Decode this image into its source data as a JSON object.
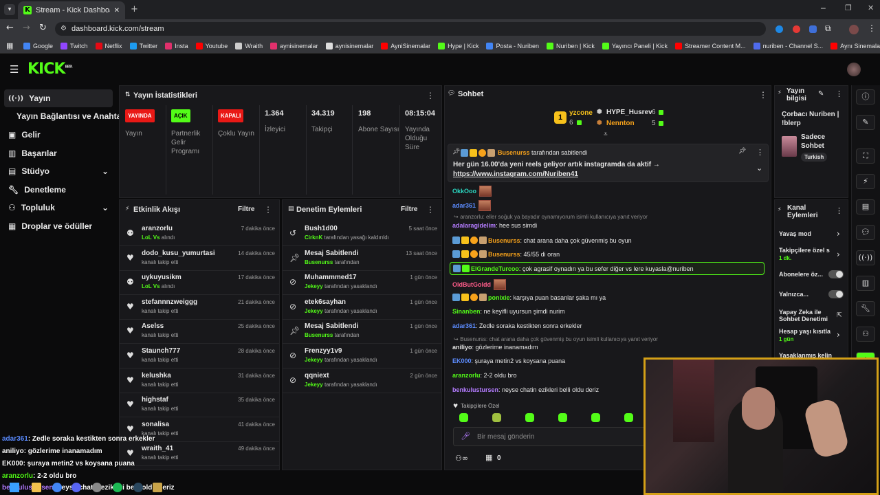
{
  "browser": {
    "tab_title": "Stream - Kick Dashboard",
    "url": "dashboard.kick.com/stream",
    "bookmarks": [
      {
        "label": "Google",
        "color": "#4285f4"
      },
      {
        "label": "Twitch",
        "color": "#9146ff"
      },
      {
        "label": "Netflix",
        "color": "#e50914"
      },
      {
        "label": "Twitter",
        "color": "#1d9bf0"
      },
      {
        "label": "Insta",
        "color": "#e1306c"
      },
      {
        "label": "Youtube",
        "color": "#ff0000"
      },
      {
        "label": "Wraith",
        "color": "#cccccc"
      },
      {
        "label": "aynisinemalar",
        "color": "#e1306c"
      },
      {
        "label": "aynisinemalar",
        "color": "#dddddd"
      },
      {
        "label": "AyniSinemalar",
        "color": "#ff0000"
      },
      {
        "label": "Hype | Kick",
        "color": "#53fc18"
      },
      {
        "label": "Posta - Nuriben",
        "color": "#4285f4"
      },
      {
        "label": "Nuriben | Kick",
        "color": "#53fc18"
      },
      {
        "label": "Yayıncı Paneli | Kick",
        "color": "#53fc18"
      },
      {
        "label": "Streamer Content M...",
        "color": "#ff0000"
      },
      {
        "label": "nuriben - Channel S...",
        "color": "#4f6bed"
      },
      {
        "label": "Aynı Sinemalar - Ça...",
        "color": "#ff0000"
      }
    ]
  },
  "sidebar": {
    "items": [
      {
        "label": "Yayın",
        "icon": "broadcast-icon"
      },
      {
        "label": "Yayın Bağlantısı ve Anahtarı"
      },
      {
        "label": "Gelir",
        "icon": "revenue-icon"
      },
      {
        "label": "Başarılar",
        "icon": "achievements-icon"
      },
      {
        "label": "Stüdyo",
        "icon": "studio-icon"
      },
      {
        "label": "Denetleme",
        "icon": "wrench-icon"
      },
      {
        "label": "Topluluk",
        "icon": "community-icon"
      },
      {
        "label": "Droplar ve ödüller",
        "icon": "drops-icon"
      }
    ]
  },
  "stats": {
    "title": "Yayın İstatistikleri",
    "cols": [
      {
        "badge": "YAYINDA",
        "badge_color": "#e91916",
        "label": "Yayın"
      },
      {
        "badge": "AÇIK",
        "badge_color": "#53fc18",
        "label": "Partnerlik Gelir Programı"
      },
      {
        "badge": "KAPALI",
        "badge_color": "#e91916",
        "label": "Çoklu Yayın"
      },
      {
        "value": "1.364",
        "label": "İzleyici"
      },
      {
        "value": "34.319",
        "label": "Takipçi"
      },
      {
        "value": "198",
        "label": "Abone Sayısı"
      },
      {
        "value": "08:15:04",
        "label": "Yayında Olduğu Süre"
      }
    ]
  },
  "activity": {
    "title": "Etkinlik Akışı",
    "filter": "Filtre",
    "items": [
      {
        "name": "aranzorlu",
        "sub_green": "LoL Vs",
        "sub": "alındı",
        "time": "7 dakika önce",
        "icon": "prediction-icon"
      },
      {
        "name": "dodo_kusu_yumurtasi",
        "sub": "kanalı takip etti",
        "time": "14 dakika önce",
        "icon": "heart-icon"
      },
      {
        "name": "uykuyusikm",
        "sub_green": "LoL Vs",
        "sub": "alındı",
        "time": "17 dakika önce",
        "icon": "prediction-icon"
      },
      {
        "name": "stefannnzweiggg",
        "sub": "kanalı takip etti",
        "time": "21 dakika önce",
        "icon": "heart-icon"
      },
      {
        "name": "Aselss",
        "sub": "kanalı takip etti",
        "time": "25 dakika önce",
        "icon": "heart-icon"
      },
      {
        "name": "Staunch777",
        "sub": "kanalı takip etti",
        "time": "28 dakika önce",
        "icon": "heart-icon"
      },
      {
        "name": "kelushka",
        "sub": "kanalı takip etti",
        "time": "31 dakika önce",
        "icon": "heart-icon"
      },
      {
        "name": "highstaf",
        "sub": "kanalı takip etti",
        "time": "35 dakika önce",
        "icon": "heart-icon"
      },
      {
        "name": "sonalisa",
        "sub": "kanalı takip etti",
        "time": "41 dakika önce",
        "icon": "heart-icon"
      },
      {
        "name": "wraith_41",
        "sub": "kanalı takip etti",
        "time": "49 dakika önce",
        "icon": "heart-icon"
      }
    ]
  },
  "moderation": {
    "title": "Denetim Eylemleri",
    "filter": "Filtre",
    "items": [
      {
        "name": "Bush1d00",
        "sub_green": "CirknK",
        "sub": "tarafından yasağı kaldırıldı",
        "time": "5 saat önce",
        "icon": "unban-icon"
      },
      {
        "name": "Mesaj Sabitlendi",
        "sub_green": "Busenurss",
        "sub": "tarafından",
        "time": "13 saat önce",
        "icon": "pin-icon"
      },
      {
        "name": "Muhammmed17",
        "sub_green": "Jekeyy",
        "sub": "tarafından yasaklandı",
        "time": "1 gün önce",
        "icon": "ban-icon"
      },
      {
        "name": "etek6sayhan",
        "sub_green": "Jekeyy",
        "sub": "tarafından yasaklandı",
        "time": "1 gün önce",
        "icon": "ban-icon"
      },
      {
        "name": "Mesaj Sabitlendi",
        "sub_green": "Busenurss",
        "sub": "tarafından",
        "time": "1 gün önce",
        "icon": "pin-icon"
      },
      {
        "name": "Frenzyy1v9",
        "sub_green": "Jekeyy",
        "sub": "tarafından yasaklandı",
        "time": "1 gün önce",
        "icon": "ban-icon"
      },
      {
        "name": "qqniext",
        "sub_green": "Jekeyy",
        "sub": "tarafından yasaklandı",
        "time": "2 gün önce",
        "icon": "ban-icon"
      }
    ]
  },
  "chat": {
    "title": "Sohbet",
    "leaders": [
      {
        "rank": "1",
        "name": "yzcone",
        "count": "6"
      },
      {
        "name": "HYPE_Husrev",
        "count": "6"
      },
      {
        "name": "Nennton",
        "count": "5"
      }
    ],
    "pinned": {
      "by": "Busenurss",
      "by_suffix": "tarafından sabitlendi",
      "text": "Her gün 16.00'da yeni reels geliyor artık instagramda da aktif →",
      "link": "https://www.instagram.com/Nuriben41"
    },
    "messages": [
      {
        "user": "OkkOoo",
        "color": "#2bd9c3",
        "text": "",
        "emote": true
      },
      {
        "user": "adar361",
        "color": "#5c8cff",
        "text": "",
        "emote": true
      },
      {
        "reply": "aranzorlu: eller soğuk ya bayadır oynamıyorum isimli kullanıcıya yanıt veriyor"
      },
      {
        "user": "adalaragidelim",
        "color": "#b47cff",
        "text": "hee sus simdi"
      },
      {
        "user": "Busenurss",
        "color": "#f7a21b",
        "text": "chat arana daha çok güvenmiş bu oyun",
        "badges": true
      },
      {
        "user": "Busenurss",
        "color": "#f7a21b",
        "text": "45/55 di oran",
        "badges": true
      },
      {
        "user": "ElGrandeTurcoo",
        "color": "#53fc18",
        "text": "çok agrasif oynadın ya bu sefer diğer vs lere kuyasla@nuriben",
        "highlight": true
      },
      {
        "user": "OldButGoldd",
        "color": "#ff5c8a",
        "text": "",
        "emote": true
      },
      {
        "user": "ponixie",
        "color": "#53fc18",
        "text": "karşıya puan basanlar şaka mı ya",
        "badges": true
      },
      {
        "user": "Sinanben",
        "color": "#53fc18",
        "text": "ne keyifli uyursun şimdi nurim"
      },
      {
        "user": "adar361",
        "color": "#5c8cff",
        "text": "Zedle soraka kestikten sonra erkekler"
      },
      {
        "reply": "Busenurss: chat arana daha çok güvenmiş bu oyun isimli kullanıcıya yanıt veriyor"
      },
      {
        "user": "aniliyo",
        "color": "#e6e6e6",
        "text": "gözlerime inanamadım"
      },
      {
        "user": "EK000",
        "color": "#5c8cff",
        "text": "şuraya metin2 vs koysana puana"
      },
      {
        "user": "aranzorlu",
        "color": "#53fc18",
        "text": "2-2 oldu bro"
      },
      {
        "user": "benkulustursen",
        "color": "#b47cff",
        "text": "neyse chatin ezikleri belli oldu deriz"
      }
    ],
    "followers_only": "Takipçilere Özel",
    "input_placeholder": "Bir mesaj gönderin",
    "points": "0"
  },
  "stream_info": {
    "title": "Yayın bilgisi",
    "stream_title": "Çorbacı Nuriben | !blerp",
    "category": "Sadece Sohbet",
    "tag": "Turkish"
  },
  "channel_actions": {
    "title": "Kanal Eylemleri",
    "items": [
      {
        "label": "Yavaş mod"
      },
      {
        "label": "Takipçilere özel s",
        "sub": "1 dk."
      },
      {
        "label": "Abonelere öz..."
      },
      {
        "label": "Yalnızca..."
      },
      {
        "label": "Yapay Zeka ile Sohbet Denetimi"
      },
      {
        "label": "Hesap yaşı kısıtla",
        "sub": "1 gün"
      },
      {
        "label": "Yasaklanmış kelin"
      }
    ]
  },
  "overlay": [
    {
      "user": "adar361",
      "color": "#5c8cff",
      "text": ": Zedle soraka kestikten sonra erkekler"
    },
    {
      "user": "aniliyo",
      "color": "#ffffff",
      "text": ": gözlerime inanamadım"
    },
    {
      "user": "EK000",
      "color": "#ffffff",
      "text": ": şuraya metin2 vs koysana puana"
    },
    {
      "user": "aranzorlu",
      "color": "#53fc18",
      "text": ": 2-2 oldu bro"
    },
    {
      "user": "benkulustursen",
      "color": "#b47cff",
      "text": ": neyse chatin ezikleri belli oldu deriz"
    }
  ]
}
